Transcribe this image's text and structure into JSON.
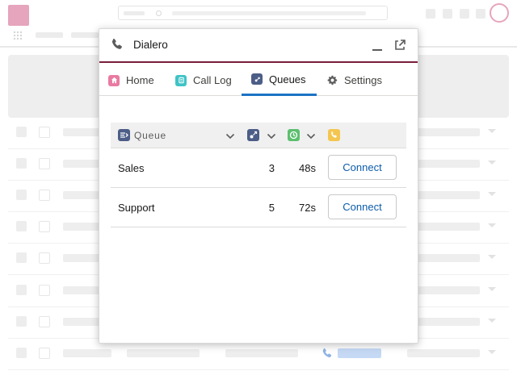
{
  "dialer": {
    "title": "Dialero",
    "tabs": [
      {
        "label": "Home",
        "icon": "home-icon",
        "color": "#e97aa1"
      },
      {
        "label": "Call Log",
        "icon": "call-log-icon",
        "color": "#3fc3c6"
      },
      {
        "label": "Queues",
        "icon": "queues-icon",
        "color": "#4c5d87",
        "active": true
      },
      {
        "label": "Settings",
        "icon": "gear-icon",
        "color": "#5c5c5c"
      }
    ],
    "queue_table": {
      "header_label": "Queue",
      "column_icons": [
        "agents-icon",
        "timer-icon",
        "phone-icon"
      ],
      "rows": [
        {
          "name": "Sales",
          "count": "3",
          "wait": "48s",
          "action": "Connect"
        },
        {
          "name": "Support",
          "count": "5",
          "wait": "72s",
          "action": "Connect"
        }
      ]
    }
  },
  "colors": {
    "accent": "#1b73c4",
    "header_rule": "#7a1e3b",
    "link": "#0b5cab",
    "brand_pink": "#e6a5bd"
  }
}
